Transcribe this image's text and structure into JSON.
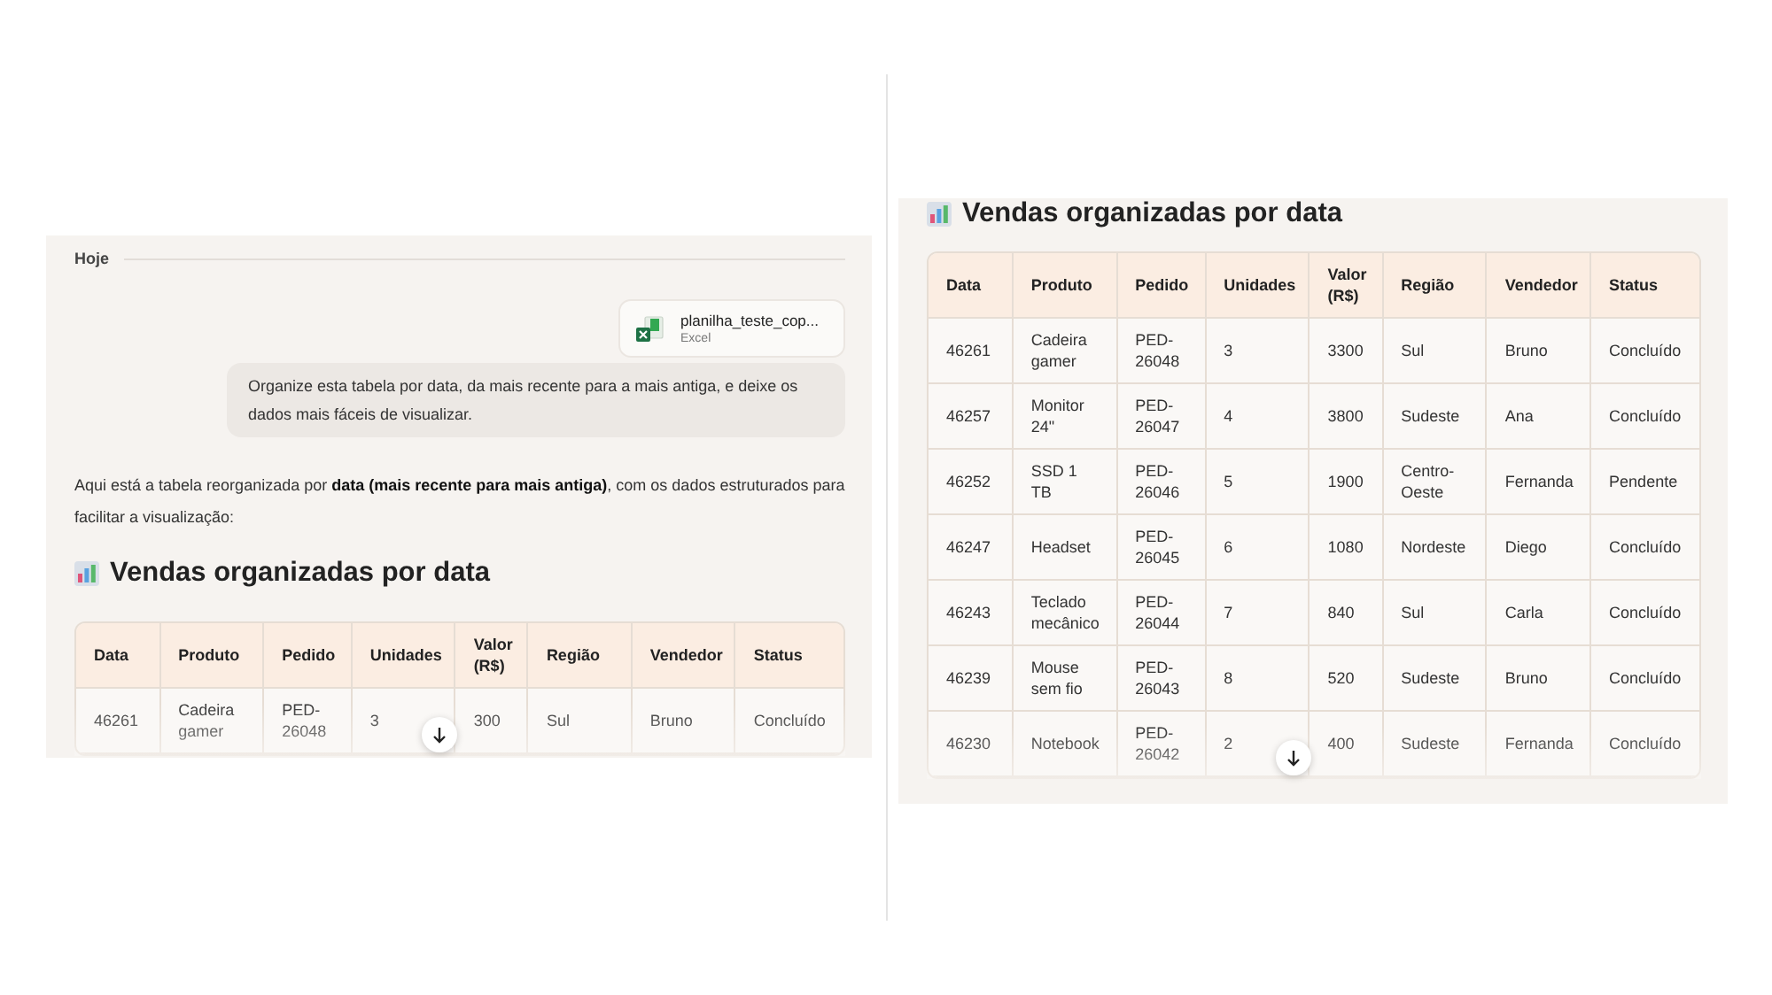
{
  "left_panel": {
    "date_separator": "Hoje",
    "attachment": {
      "name": "planilha_teste_cop...",
      "type": "Excel"
    },
    "user_message": "Organize esta tabela por data, da mais recente para a mais antiga, e deixe os dados mais fáceis de visualizar.",
    "reply": "Aqui está a tabela reorganizada por **data (mais recente para mais antiga)**, com os dados estruturados para facilitar a visualização:",
    "heading": "Vendas organizadas por data",
    "table": {
      "columns": [
        "Data",
        "Produto",
        "Pedido",
        "Unidades",
        "Valor (R$)",
        "Região",
        "Vendedor",
        "Status"
      ],
      "rows": [
        [
          "46261",
          "Cadeira gamer",
          "PED-26048",
          "3",
          "300",
          "Sul",
          "Bruno",
          "Concluído"
        ]
      ]
    }
  },
  "right_panel": {
    "heading": "Vendas organizadas por data",
    "table": {
      "columns": [
        "Data",
        "Produto",
        "Pedido",
        "Unidades",
        "Valor (R$)",
        "Região",
        "Vendedor",
        "Status"
      ],
      "rows": [
        [
          "46261",
          "Cadeira gamer",
          "PED-26048",
          "3",
          "3300",
          "Sul",
          "Bruno",
          "Concluído"
        ],
        [
          "46257",
          "Monitor 24\"",
          "PED-26047",
          "4",
          "3800",
          "Sudeste",
          "Ana",
          "Concluído"
        ],
        [
          "46252",
          "SSD 1 TB",
          "PED-26046",
          "5",
          "1900",
          "Centro-Oeste",
          "Fernanda",
          "Pendente"
        ],
        [
          "46247",
          "Headset",
          "PED-26045",
          "6",
          "1080",
          "Nordeste",
          "Diego",
          "Concluído"
        ],
        [
          "46243",
          "Teclado mecânico",
          "PED-26044",
          "7",
          "840",
          "Sul",
          "Carla",
          "Concluído"
        ],
        [
          "46239",
          "Mouse sem fio",
          "PED-26043",
          "8",
          "520",
          "Sudeste",
          "Bruno",
          "Concluído"
        ],
        [
          "46230",
          "Notebook",
          "PED-26042",
          "2",
          "400",
          "Sudeste",
          "Fernanda",
          "Concluído"
        ]
      ]
    }
  }
}
